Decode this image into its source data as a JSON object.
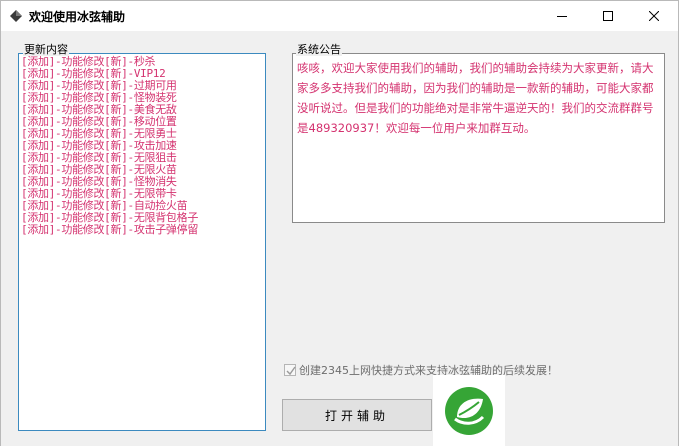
{
  "window": {
    "title": "欢迎使用冰弦辅助",
    "minimize_label": "minimize",
    "maximize_label": "maximize",
    "close_label": "close"
  },
  "updates": {
    "label": "更新内容",
    "items": [
      "[添加]-功能修改[新]-秒杀",
      "[添加]-功能修改[新]-VIP12",
      "[添加]-功能修改[新]-过期可用",
      "[添加]-功能修改[新]-怪物装死",
      "[添加]-功能修改[新]-美食无敌",
      "[添加]-功能修改[新]-移动位置",
      "[添加]-功能修改[新]-无限勇士",
      "[添加]-功能修改[新]-攻击加速",
      "[添加]-功能修改[新]-无限狙击",
      "[添加]-功能修改[新]-无限火苗",
      "[添加]-功能修改[新]-怪物消失",
      "[添加]-功能修改[新]-无限带卡",
      "[添加]-功能修改[新]-自动捡火苗",
      "[添加]-功能修改[新]-无限背包格子",
      "[添加]-功能修改[新]-攻击子弹停留"
    ]
  },
  "notice": {
    "label": "系统公告",
    "text": "咳咳，欢迎大家使用我们的辅助，我们的辅助会持续为大家更新，请大家多多支持我们的辅助，因为我们的辅助是一款新的辅助，可能大家都没听说过。但是我们的功能绝对是非常牛逼逆天的！我们的交流群群号是489320937！欢迎每一位用户来加群互动。"
  },
  "shortcut_checkbox": {
    "label": "创建2345上网快捷方式来支持冰弦辅助的后续发展！",
    "checked": true
  },
  "open_button": {
    "label": "打开辅助"
  },
  "watermark": {
    "icon": "green-leaf-logo-icon"
  },
  "colors": {
    "list_text": "#d4326f",
    "list_border": "#3c8abf",
    "logo_green": "#36a536"
  }
}
